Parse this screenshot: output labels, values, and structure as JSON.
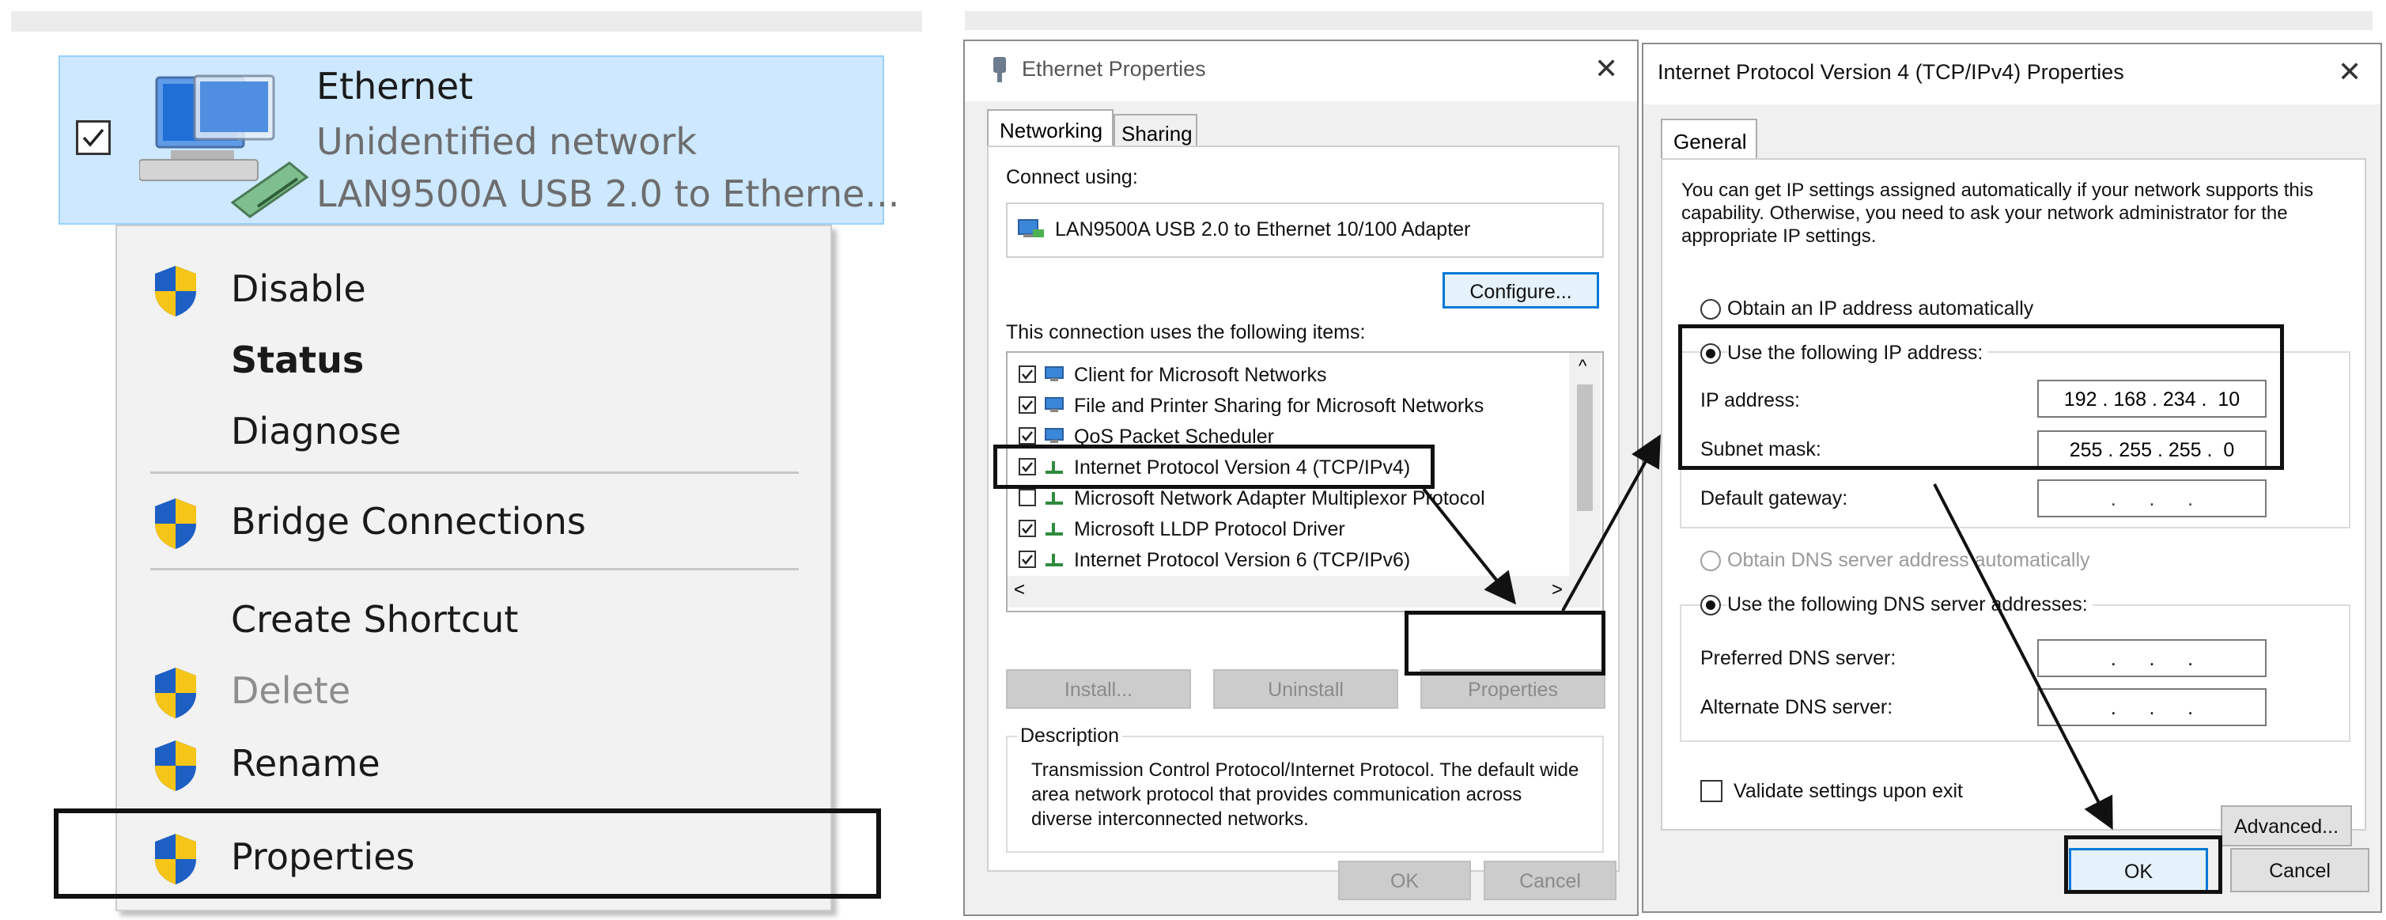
{
  "left": {
    "adapter_name": "Ethernet",
    "adapter_status": "Unidentified network",
    "adapter_device": "LAN9500A USB 2.0 to Etherne...",
    "menu": [
      {
        "label": "Disable",
        "shield": true,
        "bold": false,
        "disabled": false
      },
      {
        "label": "Status",
        "shield": false,
        "bold": true,
        "disabled": false
      },
      {
        "label": "Diagnose",
        "shield": false,
        "bold": false,
        "disabled": false
      },
      {
        "label": "Bridge Connections",
        "shield": true,
        "bold": false,
        "disabled": false
      },
      {
        "label": "Create Shortcut",
        "shield": false,
        "bold": false,
        "disabled": false
      },
      {
        "label": "Delete",
        "shield": true,
        "bold": false,
        "disabled": true
      },
      {
        "label": "Rename",
        "shield": true,
        "bold": false,
        "disabled": false
      },
      {
        "label": "Properties",
        "shield": true,
        "bold": false,
        "disabled": false
      }
    ]
  },
  "eth_props": {
    "title": "Ethernet Properties",
    "tabs": [
      "Networking",
      "Sharing"
    ],
    "connect_using_label": "Connect using:",
    "adapter": "LAN9500A USB 2.0 to Ethernet 10/100 Adapter",
    "configure_label": "Configure...",
    "items_label": "This connection uses the following items:",
    "items": [
      {
        "label": "Client for Microsoft Networks",
        "checked": true
      },
      {
        "label": "File and Printer Sharing for Microsoft Networks",
        "checked": true
      },
      {
        "label": "QoS Packet Scheduler",
        "checked": true
      },
      {
        "label": "Internet Protocol Version 4 (TCP/IPv4)",
        "checked": true
      },
      {
        "label": "Microsoft Network Adapter Multiplexor Protocol",
        "checked": false
      },
      {
        "label": "Microsoft LLDP Protocol Driver",
        "checked": true
      },
      {
        "label": "Internet Protocol Version 6 (TCP/IPv6)",
        "checked": true
      }
    ],
    "install_label": "Install...",
    "uninstall_label": "Uninstall",
    "properties_label": "Properties",
    "description_label": "Description",
    "description_text": "Transmission Control Protocol/Internet Protocol. The default wide area network protocol that provides communication across diverse interconnected networks.",
    "ok_label": "OK",
    "cancel_label": "Cancel",
    "scroll_up": "^",
    "scroll_left": "<",
    "scroll_right": ">"
  },
  "ipv4": {
    "title": "Internet Protocol Version 4 (TCP/IPv4) Properties",
    "tab": "General",
    "intro": "You can get IP settings assigned automatically if your network supports this capability. Otherwise, you need to ask your network administrator for the appropriate IP settings.",
    "obtain_ip_label": "Obtain an IP address automatically",
    "use_ip_label": "Use the following IP address:",
    "ip_label": "IP address:",
    "ip_value": "192 . 168 . 234 .  10",
    "mask_label": "Subnet mask:",
    "mask_value": "255 . 255 . 255 .  0",
    "gateway_label": "Default gateway:",
    "gateway_value": ".      .      .",
    "obtain_dns_label": "Obtain DNS server address automatically",
    "use_dns_label": "Use the following DNS server addresses:",
    "pref_dns_label": "Preferred DNS server:",
    "pref_dns_value": ".      .      .",
    "alt_dns_label": "Alternate DNS server:",
    "alt_dns_value": ".      .      .",
    "validate_label": "Validate settings upon exit",
    "advanced_label": "Advanced...",
    "ok_label": "OK",
    "cancel_label": "Cancel"
  },
  "colors": {
    "selection": "#cde8ff",
    "shield_blue": "#1e5fc4",
    "shield_yellow": "#f5c518",
    "highlight_box": "#111111"
  }
}
